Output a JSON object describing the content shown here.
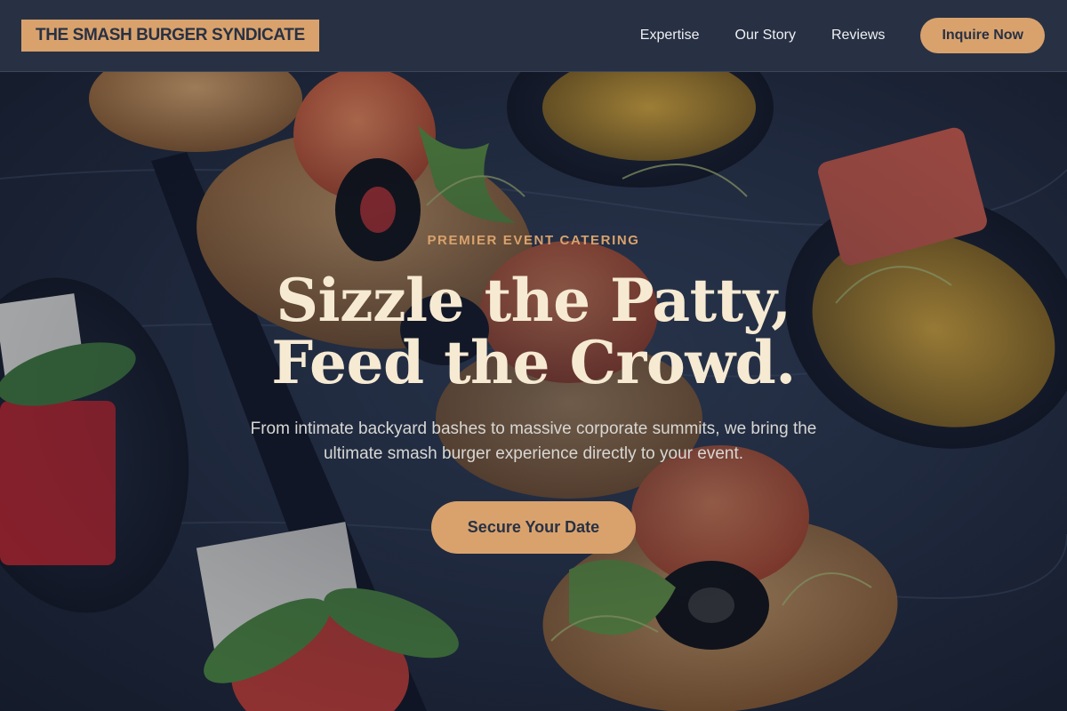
{
  "header": {
    "logo": "THE SMASH BURGER SYNDICATE",
    "nav": [
      "Expertise",
      "Our Story",
      "Reviews"
    ],
    "cta": "Inquire Now"
  },
  "hero": {
    "eyebrow": "PREMIER EVENT CATERING",
    "headline_line1": "Sizzle the Patty,",
    "headline_line2": "Feed the Crowd.",
    "subtext": "From intimate backyard bashes to massive corporate summits, we bring the ultimate smash burger experience directly to your event.",
    "cta": "Secure Your Date"
  },
  "colors": {
    "header_bg": "#283143",
    "accent": "#d9a26d",
    "headline": "#f6ead3",
    "body_text": "#d8d7d3"
  }
}
